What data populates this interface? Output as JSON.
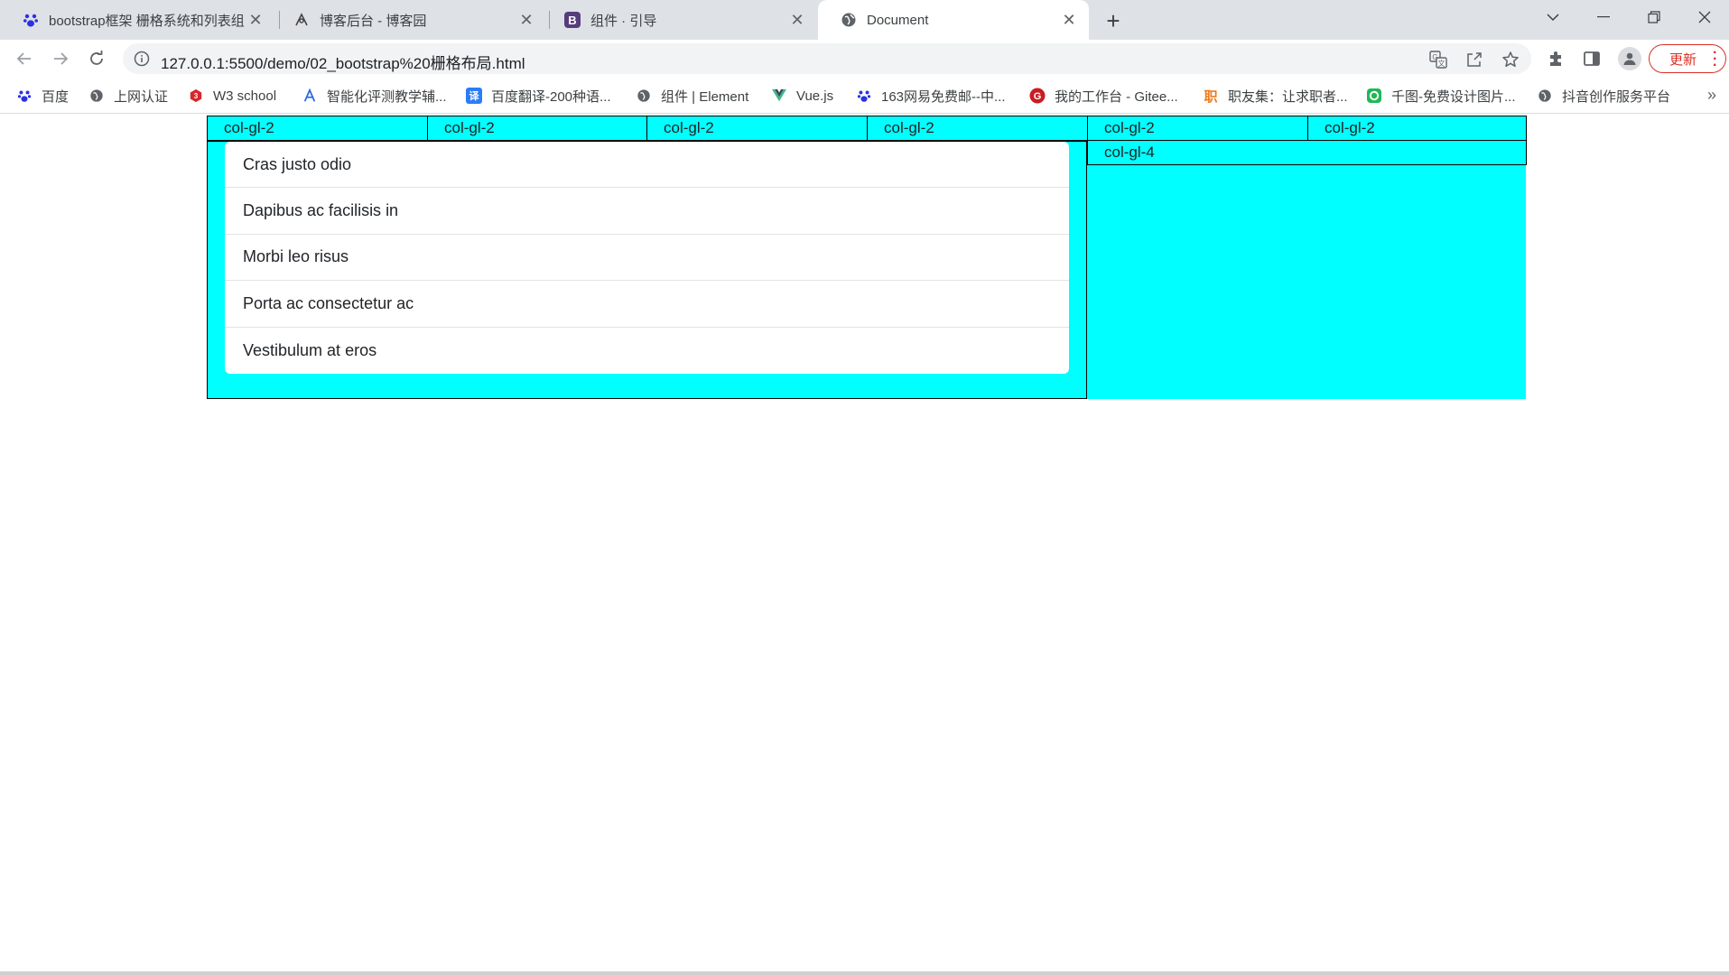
{
  "browser": {
    "tabs": [
      {
        "title": "bootstrap框架 栅格系统和列表组",
        "favicon": "baidu-paw-icon",
        "active": false
      },
      {
        "title": "博客后台 - 博客园",
        "favicon": "cnblogs-icon",
        "active": false
      },
      {
        "title": "组件 · 引导",
        "favicon": "bootstrap-icon",
        "active": false
      },
      {
        "title": "Document",
        "favicon": "globe-icon",
        "active": true
      }
    ],
    "url": "127.0.0.1:5500/demo/02_bootstrap%20栅格布局.html",
    "update_label": "更新",
    "bookmarks": [
      {
        "label": "百度",
        "icon": "baidu-paw-icon"
      },
      {
        "label": "上网认证",
        "icon": "globe-icon"
      },
      {
        "label": "W3 school",
        "icon": "w3school-icon"
      },
      {
        "label": "智能化评测教学辅...",
        "icon": "assessment-icon"
      },
      {
        "label": "百度翻译-200种语...",
        "icon": "translate-icon"
      },
      {
        "label": "组件 | Element",
        "icon": "globe-icon"
      },
      {
        "label": "Vue.js",
        "icon": "vue-icon"
      },
      {
        "label": "163网易免费邮--中...",
        "icon": "baidu-paw-icon"
      },
      {
        "label": "我的工作台 - Gitee...",
        "icon": "gitee-icon"
      },
      {
        "label": "职友集：让求职者...",
        "icon": "zhiyouji-icon"
      },
      {
        "label": "千图-免费设计图片...",
        "icon": "qiantu-icon"
      },
      {
        "label": "抖音创作服务平台",
        "icon": "globe-icon"
      }
    ]
  },
  "grid": {
    "row1": [
      "col-gl-2",
      "col-gl-2",
      "col-gl-2",
      "col-gl-2",
      "col-gl-2",
      "col-gl-2"
    ],
    "row2_right": "col-gl-4",
    "list_items": [
      "Cras justo odio",
      "Dapibus ac facilisis in",
      "Morbi leo risus",
      "Porta ac consectetur ac",
      "Vestibulum at eros"
    ]
  },
  "colors": {
    "cell_bg": "#00ffff",
    "cell_border": "#000000",
    "update_red": "#d93025"
  }
}
